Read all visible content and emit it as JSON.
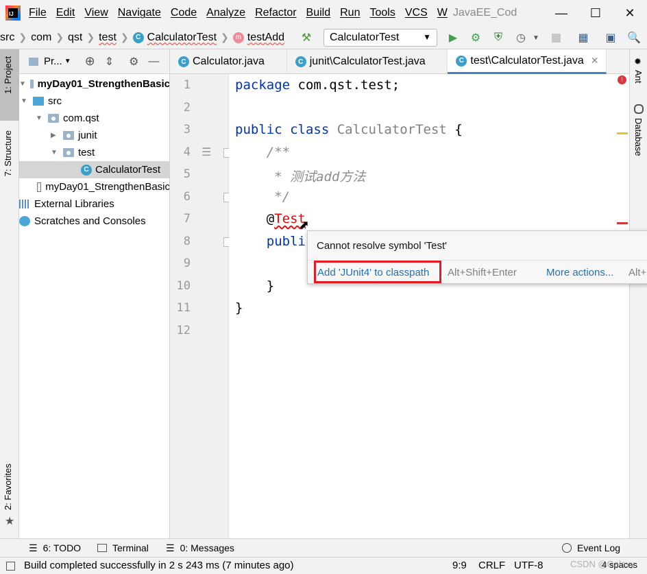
{
  "menubar": {
    "items": [
      "File",
      "Edit",
      "View",
      "Navigate",
      "Code",
      "Analyze",
      "Refactor",
      "Build",
      "Run",
      "Tools",
      "VCS",
      "W"
    ],
    "project_title": "JavaEE_Cod"
  },
  "navbar": {
    "crumbs": [
      "src",
      "com",
      "qst",
      "test",
      "CalculatorTest",
      "testAdd"
    ],
    "run_config": "CalculatorTest"
  },
  "left_strip": {
    "project_tab": "1: Project",
    "structure_tab": "7: Structure",
    "favorites_tab": "2: Favorites"
  },
  "project_panel": {
    "header_label": "Pr...",
    "tree": [
      {
        "label": "myDay01_StrengthenBasic",
        "bold": true
      },
      {
        "label": "src"
      },
      {
        "label": "com.qst"
      },
      {
        "label": "junit"
      },
      {
        "label": "test"
      },
      {
        "label": "CalculatorTest"
      },
      {
        "label": "myDay01_StrengthenBasic"
      },
      {
        "label": "External Libraries"
      },
      {
        "label": "Scratches and Consoles"
      }
    ]
  },
  "editor_tabs": [
    {
      "label": "Calculator.java"
    },
    {
      "label": "junit\\CalculatorTest.java"
    },
    {
      "label": "test\\CalculatorTest.java",
      "active": true
    }
  ],
  "right_strip": {
    "ant_tab": "Ant",
    "database_tab": "Database"
  },
  "editor": {
    "line_numbers": [
      "1",
      "2",
      "3",
      "4",
      "5",
      "6",
      "7",
      "8",
      "9",
      "10",
      "11",
      "12"
    ],
    "lines": {
      "l1_kw": "package",
      "l1_rest": " com.qst.test;",
      "l3_kw": "public class",
      "l3_cls": " CalculatorTest",
      "l3_rest": " {",
      "l4": "    /**",
      "l5": "     * 测试add方法",
      "l6": "     */",
      "l7_at": "    @",
      "l7_err": "Test",
      "l8_kw": "    publi",
      "l10": "    }",
      "l11": "}"
    }
  },
  "popup": {
    "message": "Cannot resolve symbol 'Test'",
    "action": "Add 'JUnit4' to classpath",
    "action_shortcut": "Alt+Shift+Enter",
    "more_actions": "More actions...",
    "more_shortcut": "Alt+"
  },
  "bottom_bar": {
    "todo": "6: TODO",
    "terminal": "Terminal",
    "messages": "0: Messages",
    "event_log": "Event Log"
  },
  "status_bar": {
    "message": "Build completed successfully in 2 s 243 ms (7 minutes ago)",
    "position": "9:9",
    "line_sep": "CRLF",
    "encoding": "UTF-8",
    "indent": "4 spaces",
    "watermark": "CSDN @Galaxy"
  },
  "colors": {
    "keyword": "#0033b3",
    "error": "#f50000",
    "link": "#2470b3",
    "highlight_box": "#e31b23"
  }
}
